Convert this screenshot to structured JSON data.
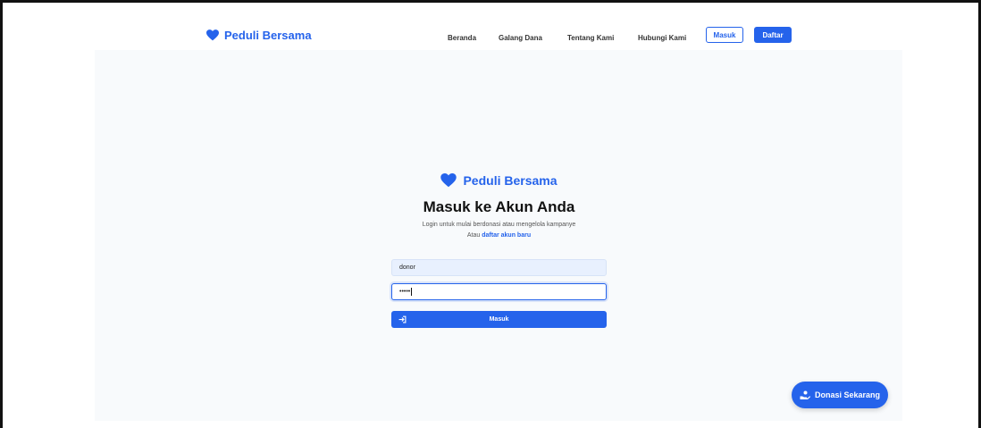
{
  "brand": {
    "name": "Peduli Bersama",
    "icon": "heart-icon",
    "color": "#2563eb"
  },
  "nav": {
    "links": [
      "Beranda",
      "Galang Dana",
      "Tentang Kami",
      "Hubungi Kami"
    ],
    "login_label": "Masuk",
    "register_label": "Daftar"
  },
  "login": {
    "brand_name": "Peduli Bersama",
    "title": "Masuk ke Akun Anda",
    "subtitle": "Login untuk mulai berdonasi atau mengelola kampanye",
    "alt_prefix": "Atau",
    "alt_link": "daftar akun baru",
    "username_value": "donor",
    "password_value": "•••••",
    "submit_label": "Masuk",
    "submit_icon": "login-icon"
  },
  "fab": {
    "label": "Donasi Sekarang",
    "icon": "hand-heart-icon"
  },
  "colors": {
    "primary": "#2563eb",
    "background": "#f8fafc",
    "input_fill": "#e8f0fe"
  }
}
